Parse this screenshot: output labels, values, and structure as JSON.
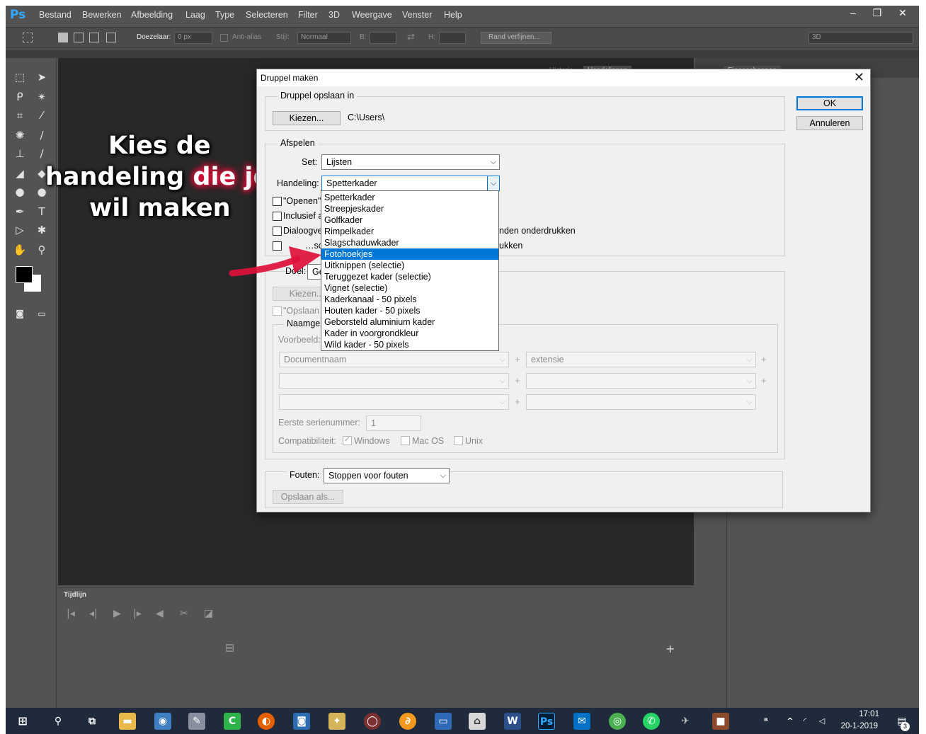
{
  "app": {
    "logo": "Ps",
    "menu": [
      "Bestand",
      "Bewerken",
      "Afbeelding",
      "Laag",
      "Type",
      "Selecteren",
      "Filter",
      "3D",
      "Weergave",
      "Venster",
      "Help"
    ],
    "window_controls": {
      "minimize": "–",
      "restore": "❐",
      "close": "✕"
    }
  },
  "options_bar": {
    "feather_label": "Doezelaar:",
    "feather_value": "0 px",
    "antialias_label": "Anti-alias",
    "style_label": "Stijl:",
    "style_value": "Normaal",
    "width_label": "B:",
    "height_label": "H:",
    "refine_button": "Rand verfijnen...",
    "workspace_value": "3D"
  },
  "panels": {
    "tab_history": "Historie",
    "tab_actions": "Handelingen",
    "tab_properties": "Eigenschappen"
  },
  "timeline": {
    "title": "Tijdlijn"
  },
  "annotation": {
    "line1": "Kies de",
    "line2_a": "handeling ",
    "line2_b": "die je",
    "line3": "wil maken"
  },
  "dialog": {
    "title": "Druppel maken",
    "save_group": {
      "title": "Druppel opslaan in",
      "choose_button": "Kiezen...",
      "path": "C:\\Users\\"
    },
    "ok_button": "OK",
    "cancel_button": "Annuleren",
    "play_group": {
      "title": "Afspelen",
      "set_label": "Set:",
      "set_value": "Lijsten",
      "action_label": "Handeling:",
      "action_value": "Spetterkader",
      "checkboxes": [
        "\"Openen\"",
        "Inclusief a",
        "Dialoogve",
        "…schu"
      ],
      "checkbox_right_1": "nden onderdrukken",
      "checkbox_right_2": "ukken"
    },
    "dropdown_items": [
      "Spetterkader",
      "Streepjeskader",
      "Golfkader",
      "Rimpelkader",
      "Slagschaduwkader",
      "Fotohoekjes",
      "Uitknippen (selectie)",
      "Teruggezet kader (selectie)",
      "Vignet (selectie)",
      "Kaderkanaal - 50 pixels",
      "Houten kader - 50 pixels",
      "Geborsteld aluminium kader",
      "Kader in voorgrondkleur",
      "Wild kader - 50 pixels"
    ],
    "selected_index": 5,
    "target_group": {
      "target_label": "Doel:",
      "target_value": "Ge",
      "choose_button": "Kiezen...",
      "save_as_checkbox": "\"Opslaan a",
      "naming_title": "Naamge",
      "preview_label": "Voorbeeld:",
      "name_field_1": "Documentnaam",
      "name_field_2": "extensie",
      "serial_label": "Eerste serienummer:",
      "serial_value": "1",
      "compat_label": "Compatibiliteit:",
      "compat_windows": "Windows",
      "compat_mac": "Mac OS",
      "compat_unix": "Unix"
    },
    "errors_label": "Fouten:",
    "errors_value": "Stoppen voor fouten",
    "save_as_button": "Opslaan als..."
  },
  "taskbar": {
    "time": "17:01",
    "date": "20-1-2019",
    "notification_badge": "3",
    "ps_label": "Ps"
  },
  "colors": {
    "accent": "#0078d7",
    "ps_dark": "#535353",
    "canvas": "#282828",
    "annotation_glow": "#e0103a"
  }
}
